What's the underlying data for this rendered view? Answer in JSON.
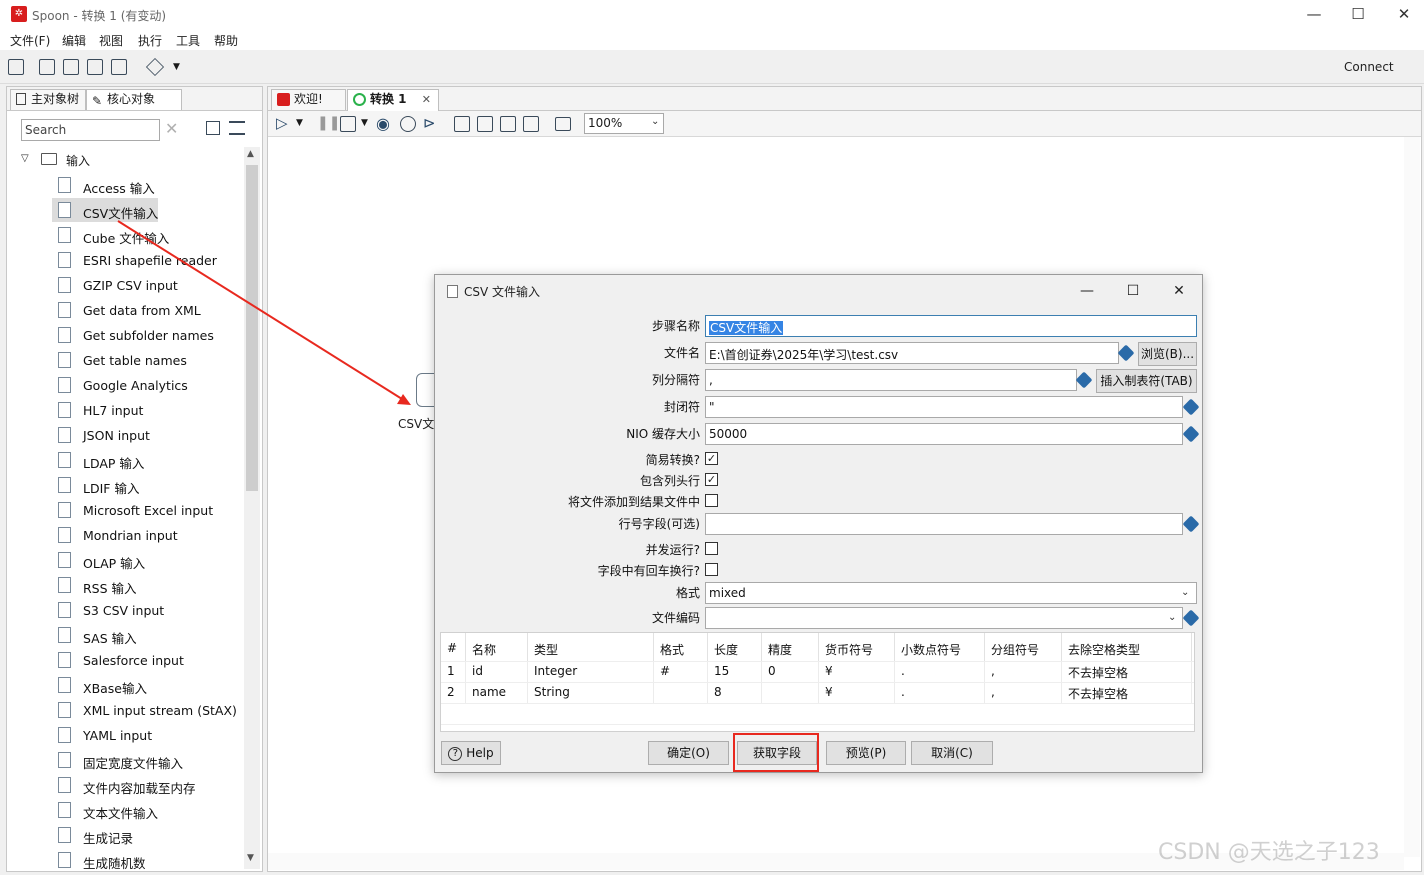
{
  "window": {
    "title": "Spoon - 转换 1 (有变动)",
    "logo_text": "✲"
  },
  "menu": [
    "文件(F)",
    "编辑",
    "视图",
    "执行",
    "工具",
    "帮助"
  ],
  "toolbar": {
    "connect_label": "Connect"
  },
  "left_panel": {
    "tabs": [
      "主对象树",
      "核心对象"
    ],
    "search_placeholder": "Search",
    "root_label": "输入",
    "items": [
      "Access 输入",
      "CSV文件输入",
      "Cube 文件输入",
      "ESRI shapefile reader",
      "GZIP CSV input",
      "Get data from XML",
      "Get subfolder names",
      "Get table names",
      "Google Analytics",
      "HL7 input",
      "JSON input",
      "LDAP 输入",
      "LDIF 输入",
      "Microsoft Excel input",
      "Mondrian input",
      "OLAP 输入",
      "RSS 输入",
      "S3 CSV input",
      "SAS 输入",
      "Salesforce input",
      "XBase输入",
      "XML input stream (StAX)",
      "YAML input",
      "固定宽度文件输入",
      "文件内容加载至内存",
      "文本文件输入",
      "生成记录",
      "生成随机数"
    ],
    "selected_index": 1
  },
  "editor": {
    "tabs": [
      {
        "label": "欢迎!",
        "active": false
      },
      {
        "label": "转换 1",
        "active": true,
        "close": "✕"
      }
    ],
    "zoom": "100%",
    "canvas_step_label": "CSV文"
  },
  "dialog": {
    "title": "CSV 文件输入",
    "fields": {
      "step_name_label": "步骤名称",
      "step_name_value": "CSV文件输入",
      "filename_label": "文件名",
      "filename_value": "E:\\首创证券\\2025年\\学习\\test.csv",
      "browse_button": "浏览(B)...",
      "delimiter_label": "列分隔符",
      "delimiter_value": ",",
      "insert_tab_button": "插入制表符(TAB)",
      "enclosure_label": "封闭符",
      "enclosure_value": "\"",
      "nio_label": "NIO 缓存大小",
      "nio_value": "50000",
      "lazy_label": "简易转换?",
      "header_label": "包含列头行",
      "add_result_label": "将文件添加到结果文件中",
      "rownum_label": "行号字段(可选)",
      "rownum_value": "",
      "parallel_label": "并发运行?",
      "newline_label": "字段中有回车换行?",
      "format_label": "格式",
      "format_value": "mixed",
      "encoding_label": "文件编码",
      "encoding_value": ""
    },
    "checks": {
      "lazy": true,
      "header": true,
      "add_result": false,
      "parallel": false,
      "newline": false
    },
    "check_mark": "✓",
    "grid": {
      "headers": [
        "#",
        "名称",
        "类型",
        "格式",
        "长度",
        "精度",
        "货币符号",
        "小数点符号",
        "分组符号",
        "去除空格类型"
      ],
      "rows": [
        [
          "1",
          "id",
          "Integer",
          "#",
          "15",
          "0",
          "¥",
          ".",
          ",",
          "不去掉空格"
        ],
        [
          "2",
          "name",
          "String",
          "",
          "8",
          "",
          "¥",
          ".",
          ",",
          "不去掉空格"
        ]
      ]
    },
    "buttons": {
      "help": "Help",
      "ok": "确定(O)",
      "get_fields": "获取字段",
      "preview": "预览(P)",
      "cancel": "取消(C)"
    }
  },
  "watermark": "CSDN @天选之子123",
  "colors": {
    "annotation_red": "#e8291f",
    "selection_blue": "#3584e4"
  }
}
